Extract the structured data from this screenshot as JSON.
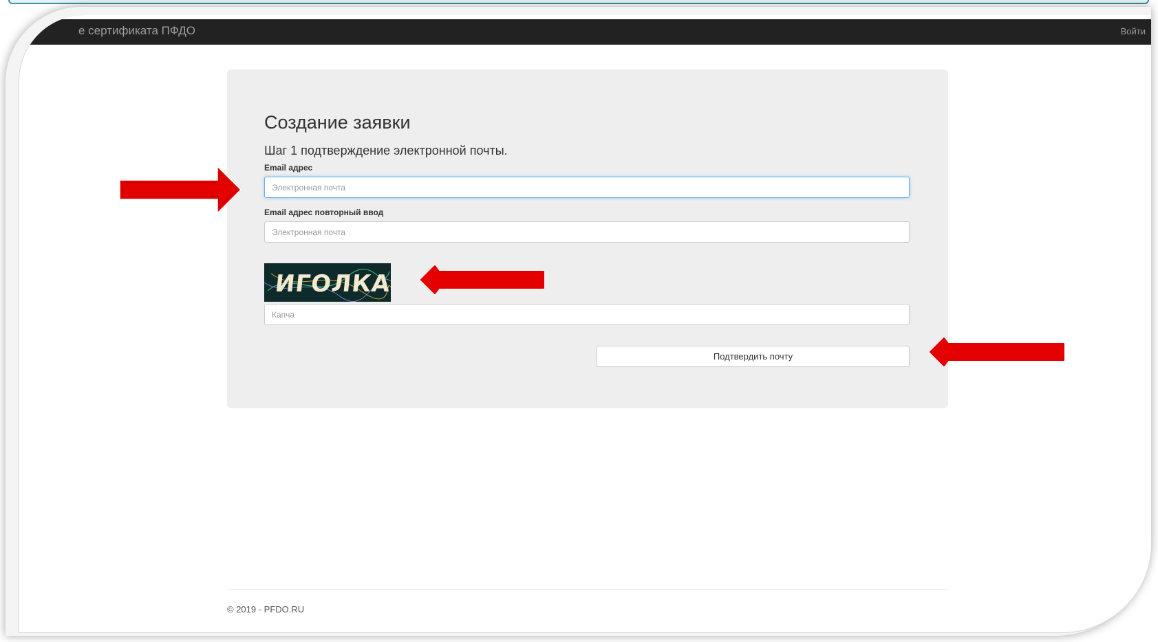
{
  "navbar": {
    "brand": "е сертификата ПФДО",
    "login": "Войти"
  },
  "form": {
    "title": "Создание заявки",
    "subtitle": "Шаг 1 подтверждение электронной почты.",
    "email": {
      "label": "Email адрес",
      "placeholder": "Электронная почта",
      "value": ""
    },
    "email_repeat": {
      "label": "Email адрес повторный ввод",
      "placeholder": "Электронная почта",
      "value": ""
    },
    "captcha": {
      "image_text": "ИГОЛКА",
      "placeholder": "Капча",
      "value": ""
    },
    "submit_label": "Подтвердить почту"
  },
  "footer": {
    "text": "© 2019 - PFDO.RU"
  },
  "colors": {
    "navbar_bg": "#222222",
    "panel_bg": "#eeeeee",
    "focus_border": "#66afe9",
    "annotation_arrow": "#e50000"
  },
  "annotations": [
    {
      "icon": "arrow-right-icon",
      "points_to": "email-input"
    },
    {
      "icon": "arrow-left-icon",
      "points_to": "captcha-image"
    },
    {
      "icon": "arrow-left-icon",
      "points_to": "confirm-email-button"
    }
  ]
}
